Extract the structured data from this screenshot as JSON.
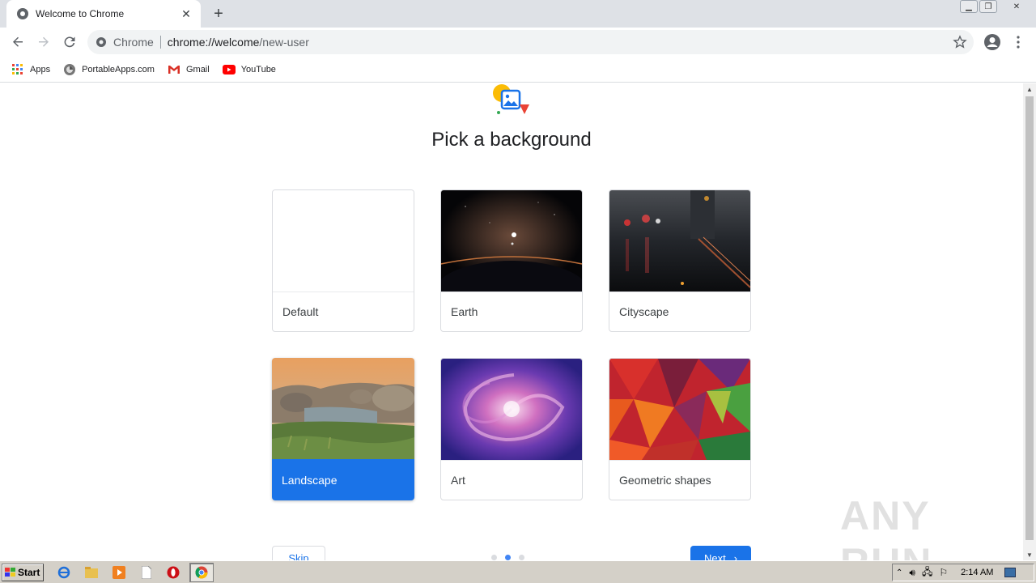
{
  "browser": {
    "tab": {
      "title": "Welcome to Chrome"
    },
    "omnibox": {
      "secure_label": "Chrome",
      "url_host": "chrome://welcome",
      "url_path": "/new-user"
    },
    "bookmarks": [
      {
        "label": "Apps",
        "icon": "apps-grid-icon"
      },
      {
        "label": "PortableApps.com",
        "icon": "portableapps-icon"
      },
      {
        "label": "Gmail",
        "icon": "gmail-icon"
      },
      {
        "label": "YouTube",
        "icon": "youtube-icon"
      }
    ]
  },
  "page": {
    "heading": "Pick a background",
    "backgrounds": [
      {
        "label": "Default",
        "selected": false
      },
      {
        "label": "Earth",
        "selected": false
      },
      {
        "label": "Cityscape",
        "selected": false
      },
      {
        "label": "Landscape",
        "selected": true
      },
      {
        "label": "Art",
        "selected": false
      },
      {
        "label": "Geometric shapes",
        "selected": false
      }
    ],
    "skip_label": "Skip",
    "next_label": "Next",
    "step": {
      "current": 2,
      "total": 3
    },
    "colors": {
      "accent": "#1a73e8",
      "active_dot": "#4285f4"
    }
  },
  "watermark": "ANY RUN",
  "taskbar": {
    "start_label": "Start",
    "clock": "2:14 AM"
  }
}
